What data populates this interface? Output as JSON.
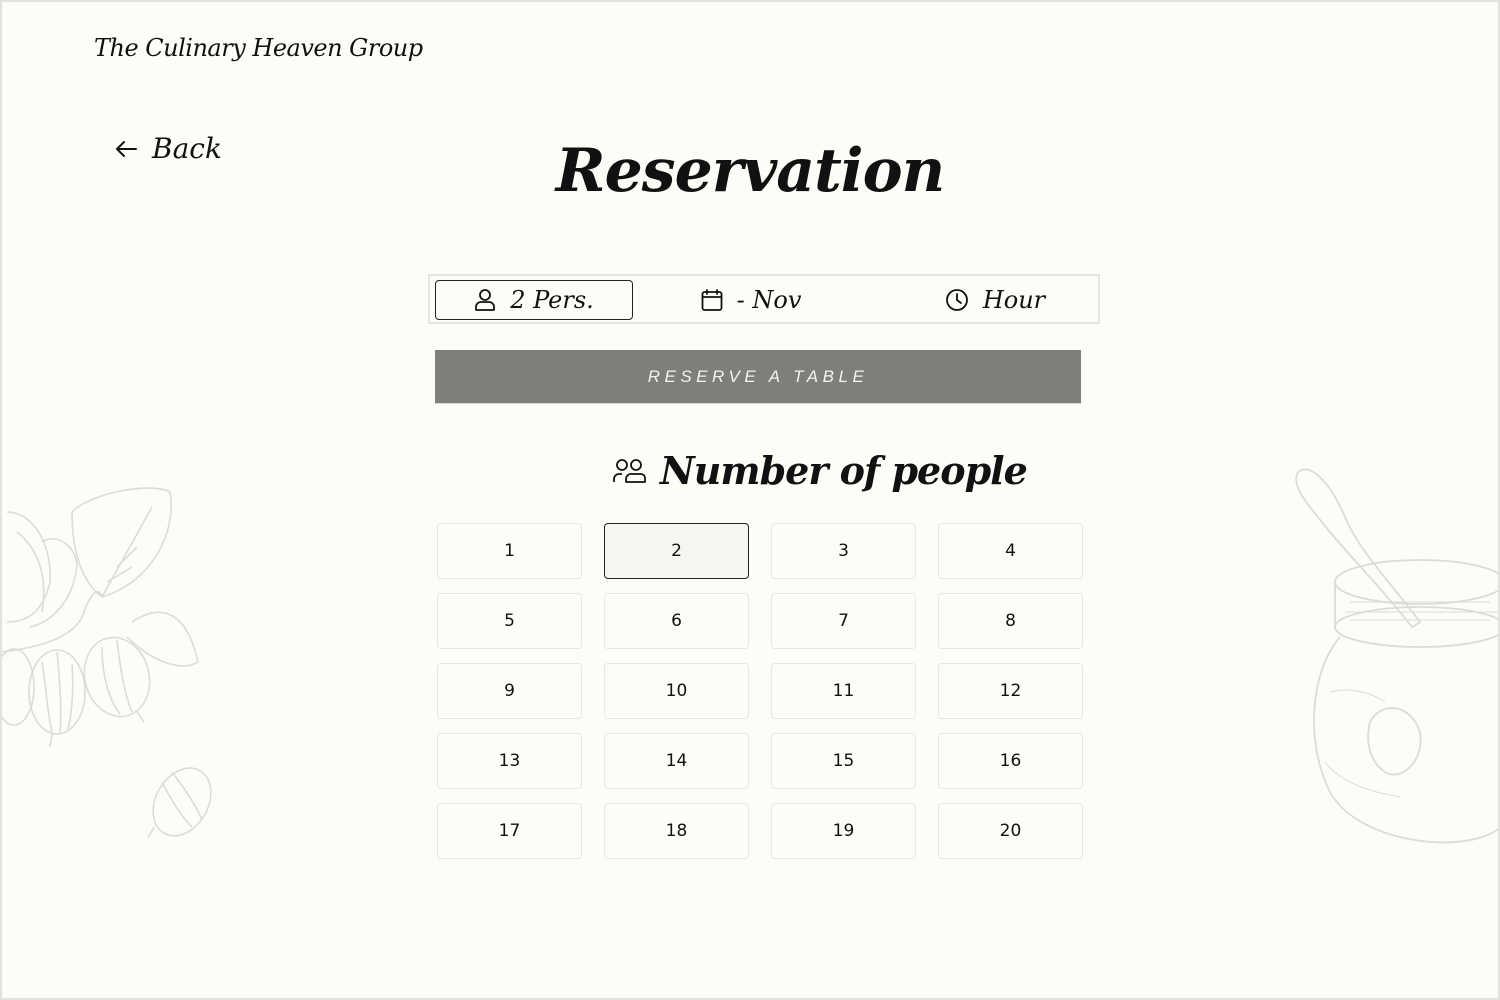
{
  "brand": {
    "name": "The Culinary Heaven Group"
  },
  "nav": {
    "back_label": "Back"
  },
  "page": {
    "title": "Reservation"
  },
  "selector": {
    "persons": {
      "icon": "person-icon",
      "label": "2 Pers."
    },
    "date": {
      "icon": "calendar-icon",
      "label": "- Nov"
    },
    "hour": {
      "icon": "clock-icon",
      "label": "Hour"
    }
  },
  "reserve_button": {
    "label": "RESERVE  A TABLE"
  },
  "people_section": {
    "icon": "people-icon",
    "heading": "Number of people",
    "selected": "2",
    "options": [
      "1",
      "2",
      "3",
      "4",
      "5",
      "6",
      "7",
      "8",
      "9",
      "10",
      "11",
      "12",
      "13",
      "14",
      "15",
      "16",
      "17",
      "18",
      "19",
      "20"
    ]
  },
  "colors": {
    "background": "#fdfdf8",
    "button": "#7e7f7a",
    "border": "#e6e6e2",
    "selected_border": "#222222",
    "decoration": "#dcdcd6"
  }
}
